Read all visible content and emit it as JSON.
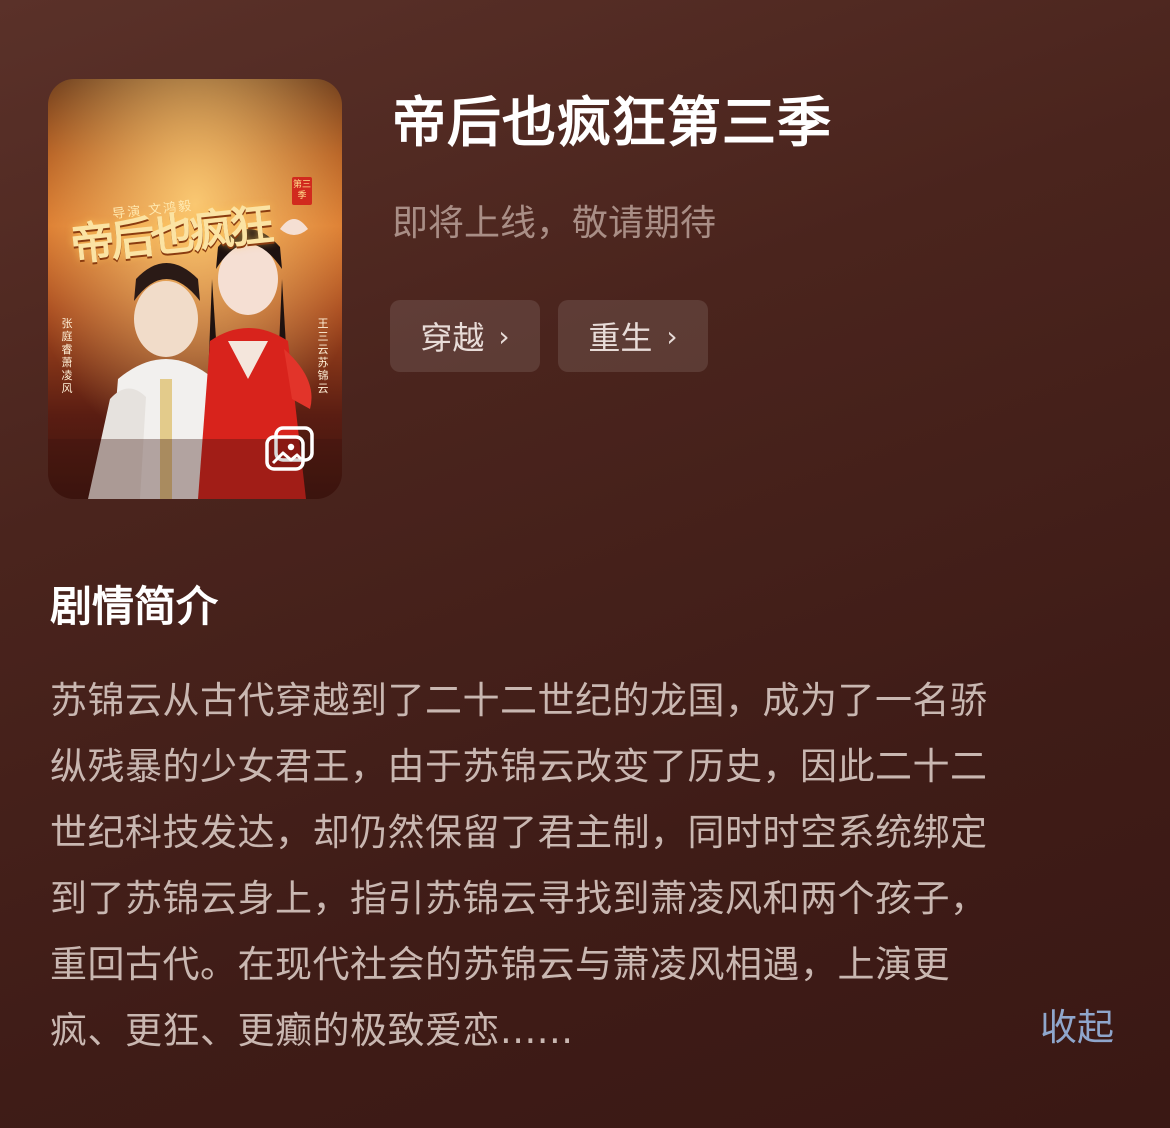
{
  "drama": {
    "title": "帝后也疯狂第三季",
    "status": "即将上线，敬请期待",
    "tags": [
      {
        "label": "穿越",
        "chevron": "›"
      },
      {
        "label": "重生",
        "chevron": "›"
      }
    ]
  },
  "poster": {
    "title_art": "帝后也疯狂",
    "director_line": "导演 文鸿毅",
    "season_badge": "第三季",
    "cast_left": "张庭睿 萧凌风",
    "cast_right": "王三云 苏锦云",
    "gallery_icon": "gallery-icon"
  },
  "synopsis": {
    "heading": "剧情简介",
    "lines": [
      "苏锦云从古代穿越到了二十二世纪的龙国，成为了一名骄",
      "纵残暴的少女君王，由于苏锦云改变了历史，因此二十二",
      "世纪科技发达，却仍然保留了君主制，同时时空系统绑定",
      "到了苏锦云身上，指引苏锦云寻找到萧凌风和两个孩子，",
      "重回古代。在现代社会的苏锦云与萧凌风相遇，上演更",
      "疯、更狂、更癫的极致爱恋......"
    ],
    "collapse_label": "收起"
  },
  "colors": {
    "background": "#4a241d",
    "title": "#ffffff",
    "status": "#a98e86",
    "body_text": "#c9b7b1",
    "link": "#8fa6cc"
  }
}
